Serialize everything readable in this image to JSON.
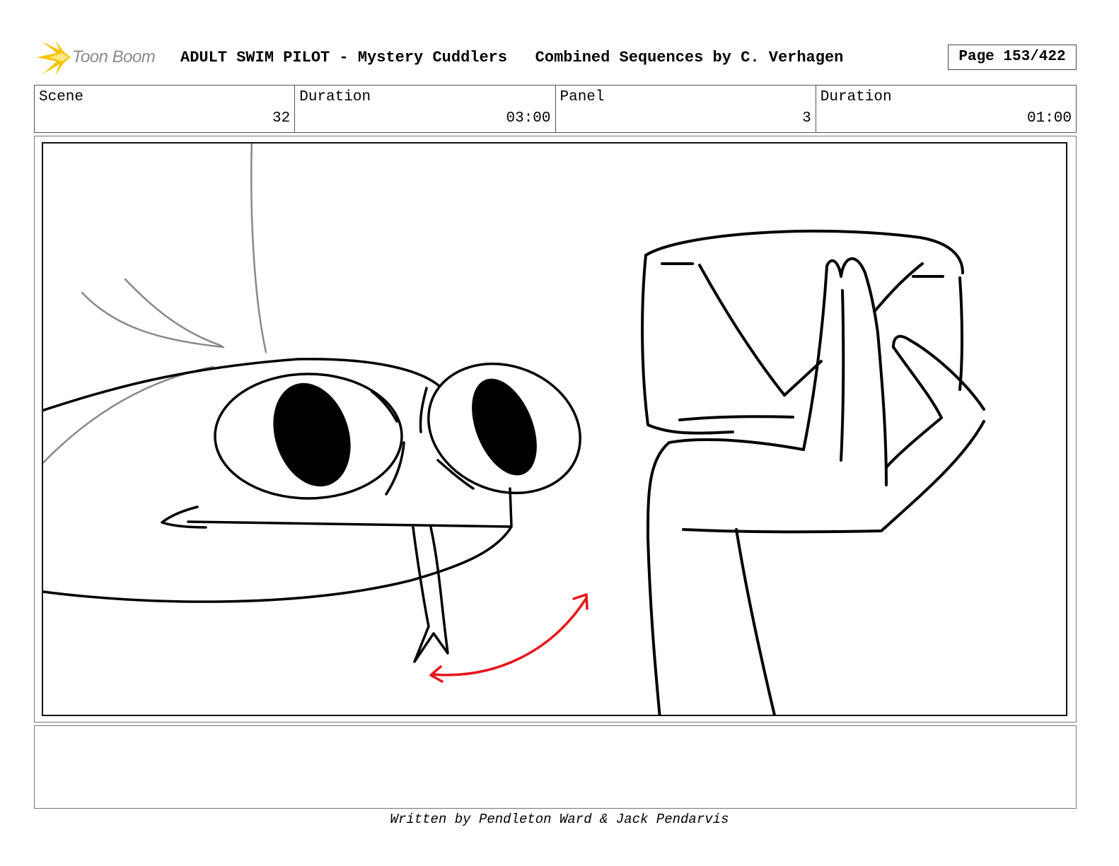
{
  "header": {
    "logo_text": "Toon Boom",
    "title": "ADULT SWIM PILOT - Mystery Cuddlers   Combined Sequences by C. Verhagen",
    "page": "Page 153/422"
  },
  "info": {
    "scene_label": "Scene",
    "scene_value": "32",
    "scene_duration_label": "Duration",
    "scene_duration_value": "03:00",
    "panel_label": "Panel",
    "panel_value": "3",
    "panel_duration_label": "Duration",
    "panel_duration_value": "01:00"
  },
  "panel": {
    "notes": ""
  },
  "footer": {
    "credit": "Written by Pendleton Ward & Jack Pendarvis"
  },
  "colors": {
    "logo_accent": "#f5c400",
    "motion_arrow": "#e8141c",
    "line_art": "#000000",
    "construction_lines": "#888888"
  },
  "icons": {
    "logo": "starburst-icon"
  }
}
